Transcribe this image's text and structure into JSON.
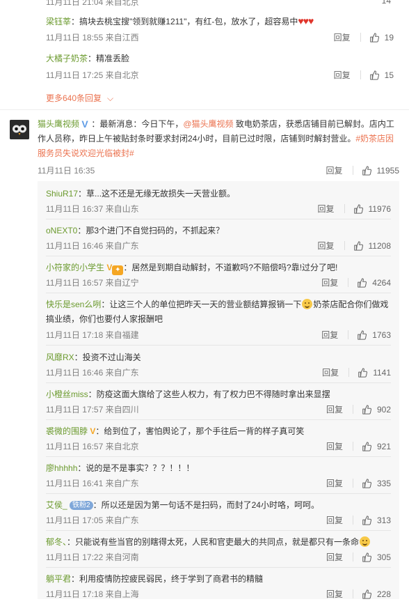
{
  "top_cut": {
    "meta": "11月11日 21:04 来自北京",
    "likes": "14"
  },
  "first_replies": [
    {
      "user": "梁钰莘",
      "text": "：搞块去桃宝搜\"领到就赚1211\"，有红-包，放水了，超容易中",
      "hearts": "♥♥♥",
      "meta": "11月11日 18:55 来自江西",
      "reply": "回复",
      "likes": "19"
    },
    {
      "user": "大橘子奶茶",
      "text": "：精准丢脸",
      "meta": "11月11日 17:25 来自北京",
      "reply": "回复",
      "likes": "15"
    }
  ],
  "more_link": "更多640条回复",
  "main_comment": {
    "user": "猫头鹰视频",
    "line1_a": "：最新消息：今日下午，",
    "mention": "@猫头鹰视频",
    "line1_b": " 致电奶茶店，获悉店铺目前已解封。店内工",
    "line2": "作人员称，昨日上午被贴封条时要求封闭24小时，目前已过时限，店铺到时解封营业。",
    "topic_a": "#奶茶店因",
    "topic_b": "服务员失说欢迎光临被封#",
    "meta": "11月11日 16:35",
    "reply": "回复",
    "likes": "11955"
  },
  "sub_replies": [
    {
      "user": "ShiuR17",
      "text": "：草...这不还是无缘无故损失一天营业额。",
      "meta": "11月11日 16:37 来自山东",
      "reply": "回复",
      "likes": "11976"
    },
    {
      "user": "oNEXT0",
      "text": "：那3个进门不自觉扫码的，不抓起来？",
      "meta": "11月11日 16:46 来自广东",
      "reply": "回复",
      "likes": "11208"
    },
    {
      "user": "小符家的小学生",
      "text": "：居然是到期自动解封，不道歉吗?不赔偿吗?靠!过分了吧!",
      "meta": "11月11日 16:57 来自辽宁",
      "reply": "回复",
      "likes": "4264"
    },
    {
      "user": "快乐是sen么咧",
      "text_a": "：让这三个人的单位把昨天一天的营业额结算报销一下",
      "text_b": "奶茶店配合你们做戏",
      "text_c": "搞业绩，你们也要付人家报酬吧",
      "meta": "11月11日 17:18 来自福建",
      "reply": "回复",
      "likes": "1763"
    },
    {
      "user": "风靡RX",
      "text": "：投资不过山海关",
      "meta": "11月11日 16:46 来自广东",
      "reply": "回复",
      "likes": "1141"
    },
    {
      "user": "小橙丝miss",
      "text": "：防疫这面大旗给了这些人权力，有了权力巴不得随时拿出来显摆",
      "meta": "11月11日 17:57 来自四川",
      "reply": "回复",
      "likes": "902"
    },
    {
      "user": "裘微的围脖",
      "text": "：给到位了，害怕舆论了，那个手往后一背的样子真可笑",
      "meta": "11月11日 16:57 来自北京",
      "reply": "回复",
      "likes": "921"
    },
    {
      "user": "廖hhhhh",
      "text": "：说的是不是事实？？？！！！",
      "meta": "11月11日 16:41 来自广东",
      "reply": "回复",
      "likes": "335"
    },
    {
      "user": "艾侯_",
      "badge": "铁粉2",
      "text": "：所以还是因为第一句话不是扫码，而封了24小时咯，呵呵。",
      "meta": "11月11日 17:05 来自广东",
      "reply": "回复",
      "likes": "313"
    },
    {
      "user": "郁冬、",
      "text": "：只能说有些当官的别瞎得太死，人民和官吏最大的共同点，就是都只有一条命",
      "meta": "11月11日 17:22 来自河南",
      "reply": "回复",
      "likes": "305"
    },
    {
      "user": "躺平君",
      "text": "：利用疫情防控疲民弱民，终于学到了商君书的精髓",
      "meta": "11月11日 17:18 来自上海",
      "reply": "回复",
      "likes": "228"
    }
  ],
  "colors": {
    "accent": "#eb7350",
    "username": "#6b9a2e",
    "meta": "#808080",
    "verified": "#5f9ce6"
  }
}
